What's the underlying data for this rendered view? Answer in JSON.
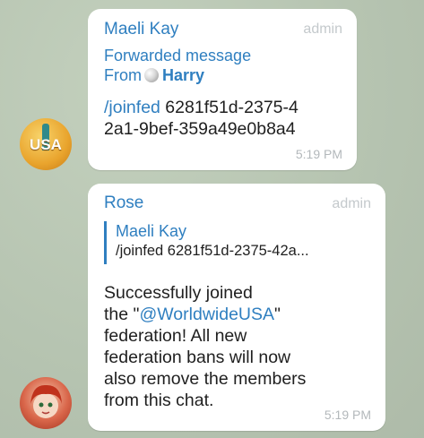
{
  "messages": [
    {
      "sender": "Maeli Kay",
      "role": "admin",
      "forwarded_label": "Forwarded message",
      "from_prefix": "From",
      "from_name": "Harry",
      "command": "/joinfed",
      "text_line1_rest": " 6281f51d-2375-4",
      "text_line2": "2a1-9bef-359a49e0b8a4",
      "time": "5:19 PM",
      "avatar_text": "USA"
    },
    {
      "sender": "Rose",
      "role": "admin",
      "reply_name": "Maeli Kay",
      "reply_text": "/joinfed 6281f51d-2375-42a...",
      "lines": [
        "Successfully joined",
        "federation! All new",
        "federation bans will now",
        "also remove the members",
        "from this chat."
      ],
      "line2_prefix": "the \"",
      "line2_link": "@WorldwideUSA",
      "line2_suffix": "\"",
      "time": "5:19 PM"
    }
  ]
}
